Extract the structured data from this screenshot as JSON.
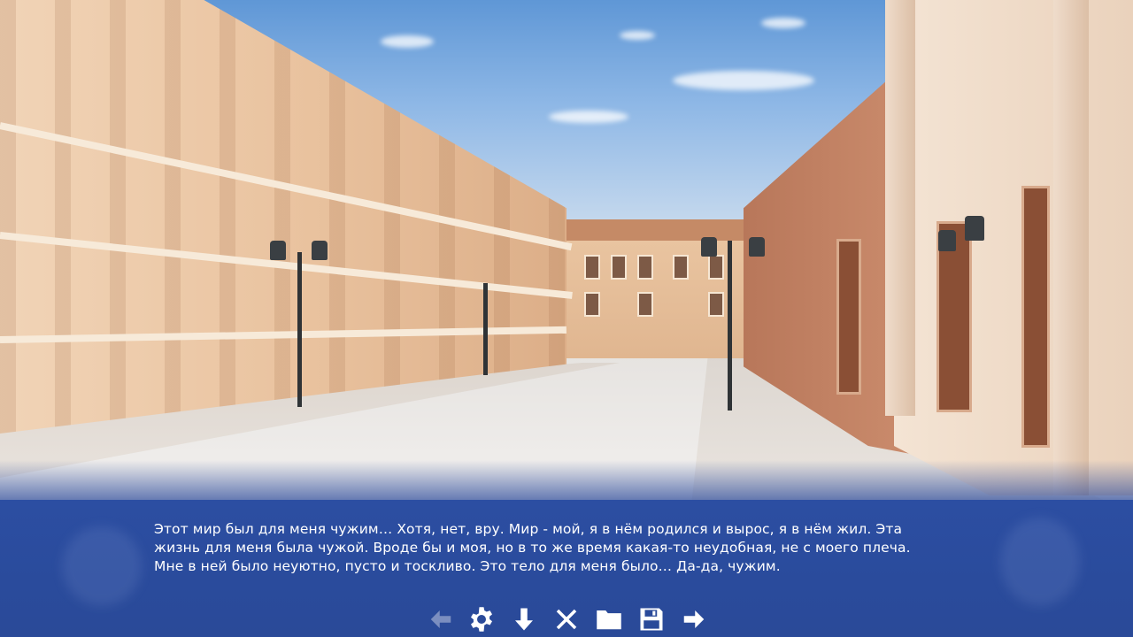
{
  "dialogue": {
    "text": "Этот мир был для меня чужим… Хотя, нет, вру. Мир - мой, я в нём родился и вырос, я в нём жил. Эта\nжизнь для меня была чужой. Вроде бы и моя, но в то же время какая-то неудобная, не с моего плеча.\nМне в ней было неуютно, пусто и тоскливо. Это тело для меня было… Да-да, чужим."
  },
  "toolbar": {
    "buttons": [
      {
        "icon": "arrow-left-icon",
        "enabled": false
      },
      {
        "icon": "gear-icon",
        "enabled": true
      },
      {
        "icon": "arrow-down-icon",
        "enabled": true
      },
      {
        "icon": "close-icon",
        "enabled": true
      },
      {
        "icon": "folder-icon",
        "enabled": true
      },
      {
        "icon": "save-icon",
        "enabled": true
      },
      {
        "icon": "arrow-right-icon",
        "enabled": true
      }
    ]
  },
  "colors": {
    "textbox": "#2c4ea2",
    "text": "#ffffff"
  }
}
